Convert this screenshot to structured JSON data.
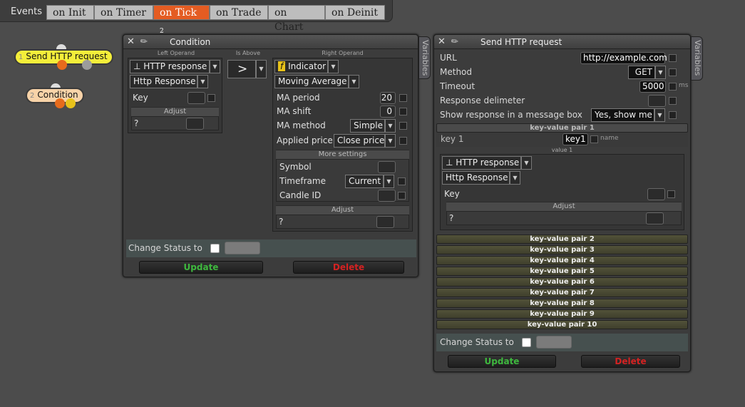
{
  "events_bar": {
    "label": "Events",
    "tabs": [
      "on Init",
      "on Timer",
      "on Tick",
      "on Trade",
      "on Chart",
      "on Deinit"
    ],
    "active_tab_badge": "2"
  },
  "nodes": [
    {
      "num": "1",
      "label": "Send HTTP request"
    },
    {
      "num": "2",
      "label": "Condition"
    }
  ],
  "condition": {
    "title": "Condition",
    "side_tab": "Variables",
    "left_operand_header": "Left Operand",
    "operator_header": "Is Above",
    "right_operand_header": "Right Operand",
    "left": {
      "type_icon": "⊥",
      "type": "HTTP response",
      "subtype": "Http Response",
      "key_label": "Key",
      "adjust_header": "Adjust",
      "adjust_value": "?"
    },
    "operator": ">",
    "right": {
      "type_icon": "f",
      "type": "Indicator",
      "subtype": "Moving Average",
      "rows": [
        {
          "label": "MA period",
          "value": "20"
        },
        {
          "label": "MA shift",
          "value": "0"
        },
        {
          "label": "MA method",
          "value": "Simple"
        },
        {
          "label": "Applied price",
          "value": "Close price"
        }
      ],
      "more_settings_header": "More settings",
      "more_rows": [
        {
          "label": "Symbol",
          "value": ""
        },
        {
          "label": "Timeframe",
          "value": "Current"
        },
        {
          "label": "Candle ID",
          "value": ""
        }
      ],
      "adjust_header": "Adjust",
      "adjust_value": "?"
    },
    "change_status_label": "Change Status to",
    "update_label": "Update",
    "delete_label": "Delete"
  },
  "http": {
    "title": "Send HTTP request",
    "side_tab": "Variables",
    "rows": [
      {
        "label": "URL",
        "value": "http://example.com"
      },
      {
        "label": "Method",
        "value": "GET"
      },
      {
        "label": "Timeout",
        "value": "5000",
        "unit": "ms"
      },
      {
        "label": "Response delimeter",
        "value": ""
      },
      {
        "label": "Show response in a message box",
        "value": "Yes, show me"
      }
    ],
    "kv1": {
      "header": "key-value pair 1",
      "key_label": "key 1",
      "key_value": "key1",
      "key_hint": "name",
      "value_header": "value 1",
      "type_icon": "⊥",
      "type": "HTTP response",
      "subtype": "Http Response",
      "key_field_label": "Key",
      "adjust_header": "Adjust",
      "adjust_value": "?"
    },
    "kv_pairs": [
      "key-value pair 2",
      "key-value pair 3",
      "key-value pair 4",
      "key-value pair 5",
      "key-value pair 6",
      "key-value pair 7",
      "key-value pair 8",
      "key-value pair 9",
      "key-value pair 10"
    ],
    "change_status_label": "Change Status to",
    "update_label": "Update",
    "delete_label": "Delete"
  },
  "colors": {
    "active_tab": "#e45c22",
    "node1": "#f4ee3a",
    "node2": "#f8d3a8",
    "update": "#3eb83e",
    "delete": "#d42222"
  }
}
